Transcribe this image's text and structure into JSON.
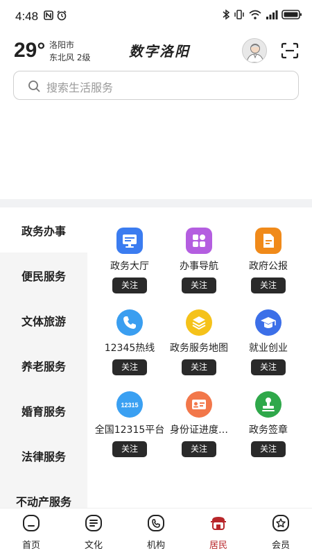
{
  "status_bar": {
    "time": "4:48"
  },
  "header": {
    "temperature": "29°",
    "city": "洛阳市",
    "wind": "东北风  2级",
    "app_title": "数字洛阳"
  },
  "search": {
    "placeholder": "搜索生活服务"
  },
  "categories": [
    {
      "label": "政务办事",
      "active": true
    },
    {
      "label": "便民服务"
    },
    {
      "label": "文体旅游"
    },
    {
      "label": "养老服务"
    },
    {
      "label": "婚育服务"
    },
    {
      "label": "法律服务"
    },
    {
      "label": "不动产服务"
    }
  ],
  "services": [
    {
      "label": "政务大厅",
      "icon": "monitor-icon",
      "color": "#3b7cf0",
      "button": "关注"
    },
    {
      "label": "办事导航",
      "icon": "apps-grid-icon",
      "color": "#b45ee0",
      "button": "关注"
    },
    {
      "label": "政府公报",
      "icon": "document-icon",
      "color": "#f08a1a",
      "button": "关注"
    },
    {
      "label": "12345热线",
      "icon": "phone-icon",
      "color": "#3a9ef0",
      "button": "关注"
    },
    {
      "label": "政务服务地图",
      "icon": "layers-icon",
      "color": "#f5c21a",
      "button": "关注"
    },
    {
      "label": "就业创业",
      "icon": "graduation-cap-icon",
      "color": "#3c6fe8",
      "button": "关注"
    },
    {
      "label": "全国12315平台",
      "icon": "badge-12315-icon",
      "badge_text": "12315",
      "color": "#3aa0f2",
      "button": "关注"
    },
    {
      "label": "身份证进度…",
      "icon": "id-card-icon",
      "color": "#f2774a",
      "button": "关注"
    },
    {
      "label": "政务签章",
      "icon": "stamp-icon",
      "color": "#2fa84a",
      "button": "关注"
    }
  ],
  "bottom_nav": [
    {
      "label": "首页",
      "icon": "home-icon"
    },
    {
      "label": "文化",
      "icon": "culture-icon"
    },
    {
      "label": "机构",
      "icon": "institution-icon"
    },
    {
      "label": "居民",
      "icon": "resident-icon",
      "active": true,
      "color": "#b8262a"
    },
    {
      "label": "会员",
      "icon": "member-icon"
    }
  ]
}
